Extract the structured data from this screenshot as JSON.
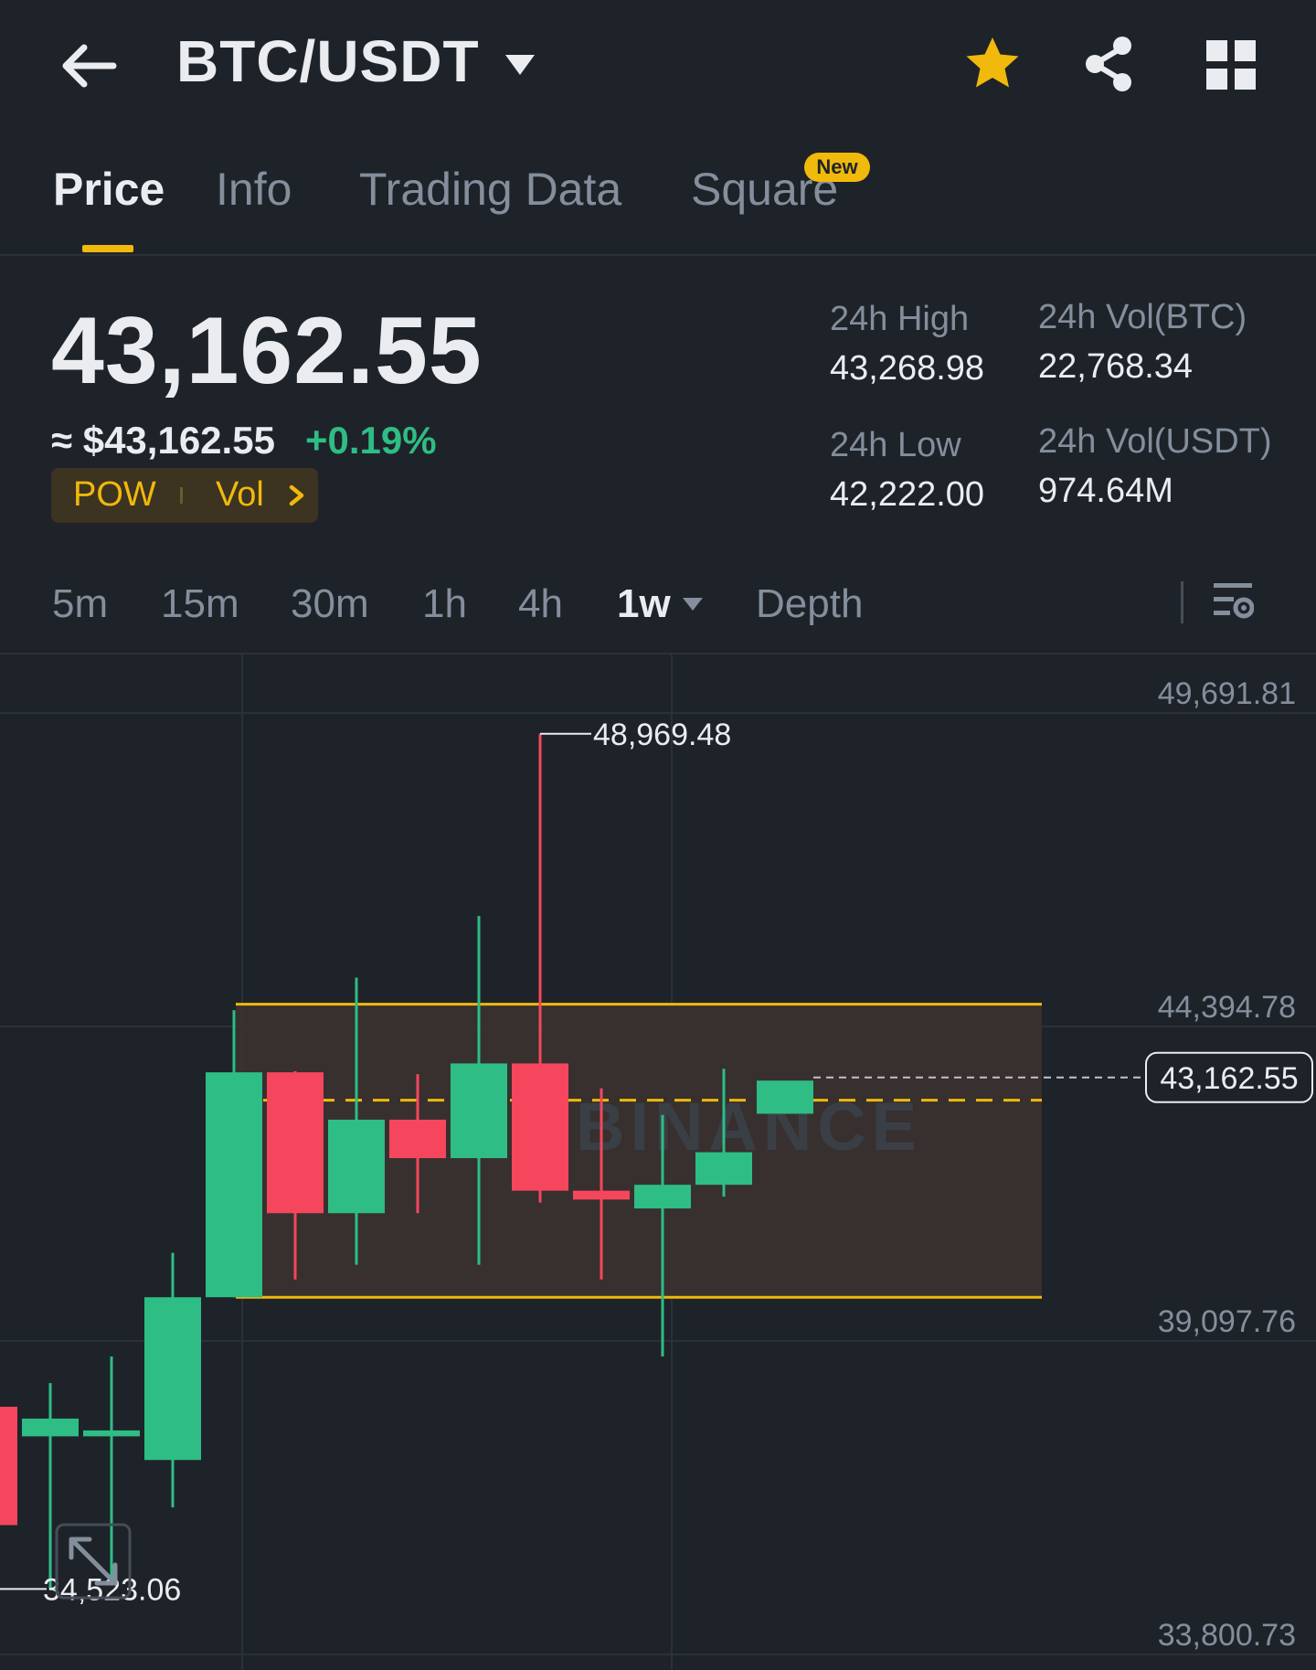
{
  "header": {
    "pair": "BTC/USDT",
    "icons": [
      "arrow-left-icon",
      "caret-down-icon",
      "star-icon",
      "share-icon",
      "grid-icon"
    ]
  },
  "tabs": [
    {
      "label": "Price",
      "active": true
    },
    {
      "label": "Info",
      "active": false
    },
    {
      "label": "Trading Data",
      "active": false
    },
    {
      "label": "Square",
      "active": false,
      "badge": "New"
    }
  ],
  "price": {
    "last": "43,162.55",
    "approx": "≈ $43,162.55",
    "change": "+0.19%",
    "tags": [
      "POW",
      "Vol"
    ]
  },
  "stats": {
    "high_label": "24h High",
    "high_value": "43,268.98",
    "low_label": "24h Low",
    "low_value": "42,222.00",
    "vol_btc_label": "24h Vol(BTC)",
    "vol_btc_value": "22,768.34",
    "vol_usdt_label": "24h Vol(USDT)",
    "vol_usdt_value": "974.64M"
  },
  "intervals": {
    "items": [
      "5m",
      "15m",
      "30m",
      "1h",
      "4h",
      "1w",
      "Depth"
    ],
    "active": "1w"
  },
  "colors": {
    "background": "#1e2329",
    "up": "#2ebd85",
    "down": "#f6465d",
    "accent": "#f0b90b",
    "muted": "#848e9c"
  },
  "chart_data": {
    "type": "candlestick",
    "interval": "1w",
    "y_axis_labels": [
      "49,691.81",
      "44,394.78",
      "39,097.76",
      "33,800.73"
    ],
    "ylim": [
      33800.73,
      49691.81
    ],
    "high_marker": "48,969.48",
    "low_marker": "34,523.06",
    "current_price_label": "43,162.55",
    "current_price": 43162.55,
    "range_box": {
      "top": 44400,
      "bottom": 39450,
      "mid": 42780
    },
    "watermark": "BINANCE",
    "candles": [
      {
        "o": 37600,
        "h": 37600,
        "c": 35600,
        "l": 34600
      },
      {
        "o": 37100,
        "h": 38000,
        "c": 37400,
        "l": 34520
      },
      {
        "o": 37100,
        "h": 38450,
        "c": 37200,
        "l": 34700
      },
      {
        "o": 36700,
        "h": 40200,
        "c": 39450,
        "l": 35900
      },
      {
        "o": 39450,
        "h": 44300,
        "c": 43250,
        "l": 39450
      },
      {
        "o": 43250,
        "h": 43270,
        "c": 40870,
        "l": 39750
      },
      {
        "o": 40870,
        "h": 44850,
        "c": 42450,
        "l": 40000
      },
      {
        "o": 42450,
        "h": 43220,
        "c": 41800,
        "l": 40870
      },
      {
        "o": 41800,
        "h": 45890,
        "c": 43400,
        "l": 40000
      },
      {
        "o": 43400,
        "h": 48969.48,
        "c": 41250,
        "l": 41050
      },
      {
        "o": 41250,
        "h": 42980,
        "c": 41100,
        "l": 39750
      },
      {
        "o": 40950,
        "h": 42530,
        "c": 41350,
        "l": 38450
      },
      {
        "o": 41350,
        "h": 43310,
        "c": 41900,
        "l": 41150
      },
      {
        "o": 42550,
        "h": 42730,
        "c": 43110,
        "l": 42550
      }
    ]
  }
}
